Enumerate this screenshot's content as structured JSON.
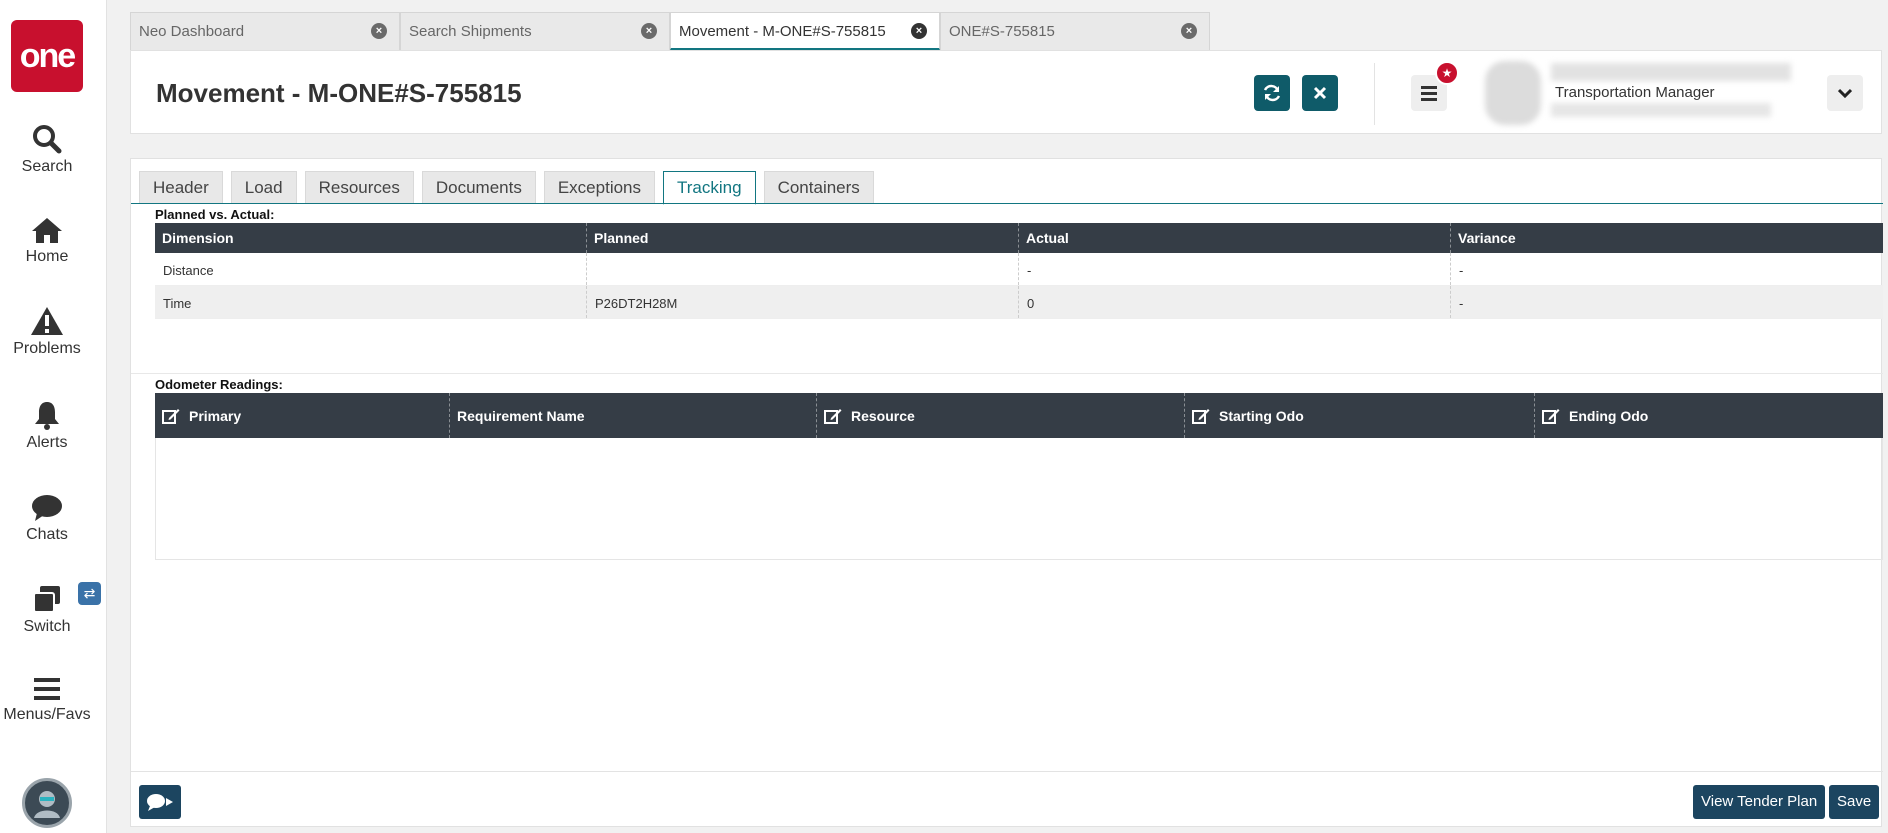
{
  "app": {
    "logo_text": "one"
  },
  "sidebar": {
    "items": [
      {
        "label": "Search",
        "icon": "search-icon"
      },
      {
        "label": "Home",
        "icon": "home-icon"
      },
      {
        "label": "Problems",
        "icon": "warning-icon"
      },
      {
        "label": "Alerts",
        "icon": "bell-icon"
      },
      {
        "label": "Chats",
        "icon": "chat-icon"
      },
      {
        "label": "Switch",
        "icon": "switch-icon"
      },
      {
        "label": "Menus/Favs",
        "icon": "menu-icon"
      }
    ]
  },
  "tabs": [
    {
      "label": "Neo Dashboard",
      "active": false
    },
    {
      "label": "Search Shipments",
      "active": false
    },
    {
      "label": "Movement - M-ONE#S-755815",
      "active": true
    },
    {
      "label": "ONE#S-755815",
      "active": false
    }
  ],
  "header": {
    "title": "Movement - M-ONE#S-755815",
    "user_role": "Transportation Manager"
  },
  "subtabs": [
    "Header",
    "Load",
    "Resources",
    "Documents",
    "Exceptions",
    "Tracking",
    "Containers"
  ],
  "active_subtab": "Tracking",
  "planned_vs_actual": {
    "label": "Planned vs. Actual:",
    "columns": [
      "Dimension",
      "Planned",
      "Actual",
      "Variance"
    ],
    "rows": [
      [
        "Distance",
        "",
        "-",
        "-"
      ],
      [
        "Time",
        "P26DT2H28M",
        "0",
        "-"
      ]
    ]
  },
  "odometer": {
    "label": "Odometer Readings:",
    "columns": [
      "Primary",
      "Requirement Name",
      "Resource",
      "Starting Odo",
      "Ending Odo"
    ]
  },
  "footer": {
    "view_tender_plan": "View Tender Plan",
    "save": "Save"
  },
  "colors": {
    "brand": "#c8102e",
    "accent": "#127681",
    "dark_button": "#0f5b69",
    "grid_header": "#353d46"
  }
}
